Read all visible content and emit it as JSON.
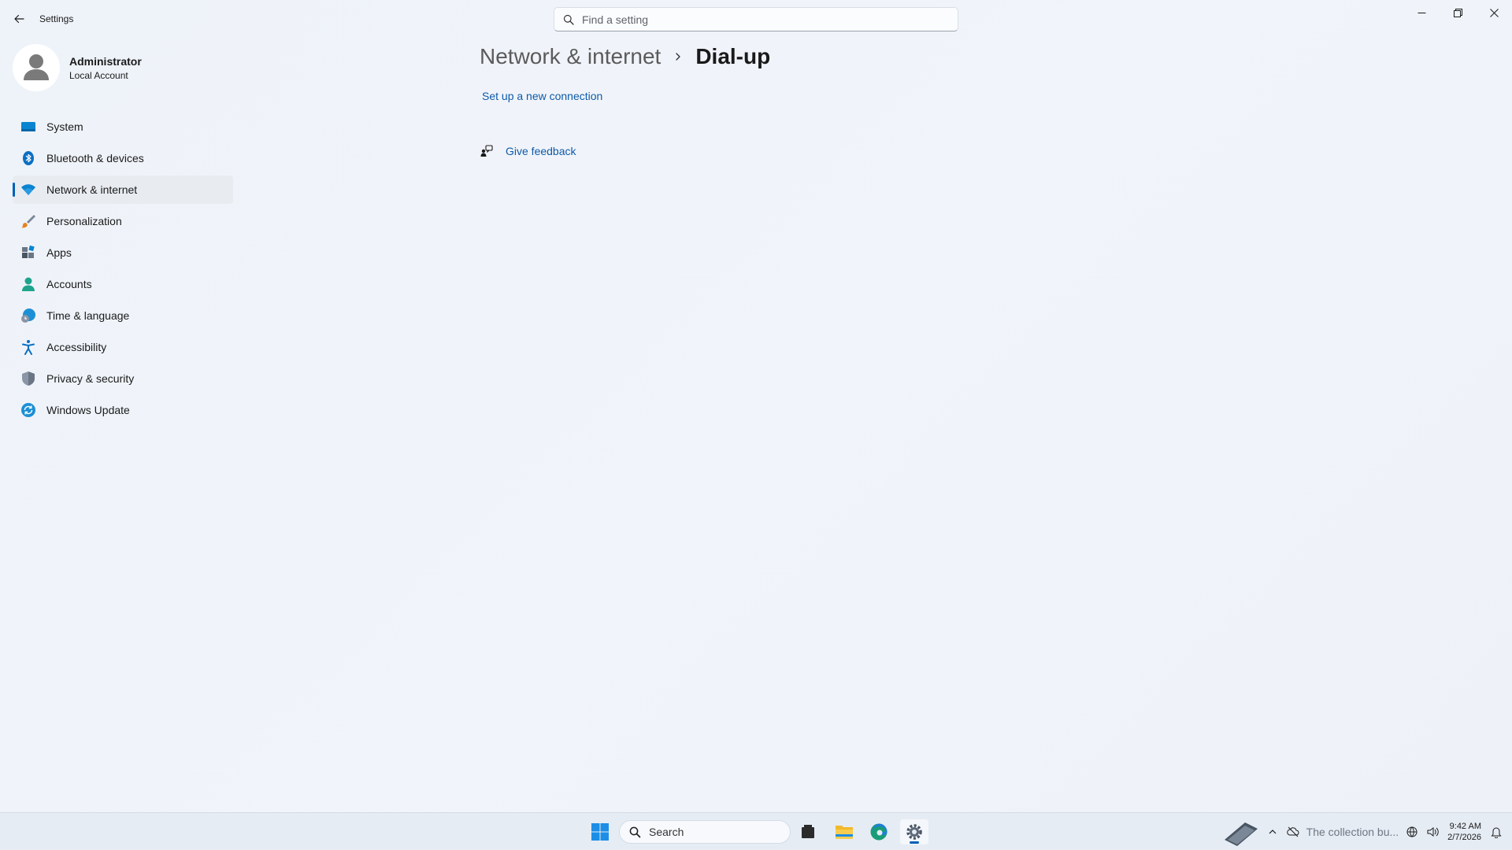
{
  "window": {
    "title": "Settings",
    "search_placeholder": "Find a setting"
  },
  "profile": {
    "name": "Administrator",
    "account_type": "Local Account"
  },
  "sidebar": {
    "items": [
      {
        "label": "System",
        "icon": "monitor-icon"
      },
      {
        "label": "Bluetooth & devices",
        "icon": "bluetooth-icon"
      },
      {
        "label": "Network & internet",
        "icon": "wifi-icon",
        "active": true
      },
      {
        "label": "Personalization",
        "icon": "brush-icon"
      },
      {
        "label": "Apps",
        "icon": "apps-icon"
      },
      {
        "label": "Accounts",
        "icon": "person-icon"
      },
      {
        "label": "Time & language",
        "icon": "globe-clock-icon"
      },
      {
        "label": "Accessibility",
        "icon": "accessibility-icon"
      },
      {
        "label": "Privacy & security",
        "icon": "shield-icon"
      },
      {
        "label": "Windows Update",
        "icon": "update-icon"
      }
    ]
  },
  "main": {
    "breadcrumb_parent": "Network & internet",
    "breadcrumb_current": "Dial-up",
    "setup_link": "Set up a new connection",
    "feedback_link": "Give feedback"
  },
  "taskbar": {
    "search_label": "Search",
    "tray_widget_text": "The collection bu...",
    "time": "9:42 AM",
    "date": "2/7/2026"
  },
  "colors": {
    "accent": "#005fb8",
    "link": "#0e5aa8"
  }
}
